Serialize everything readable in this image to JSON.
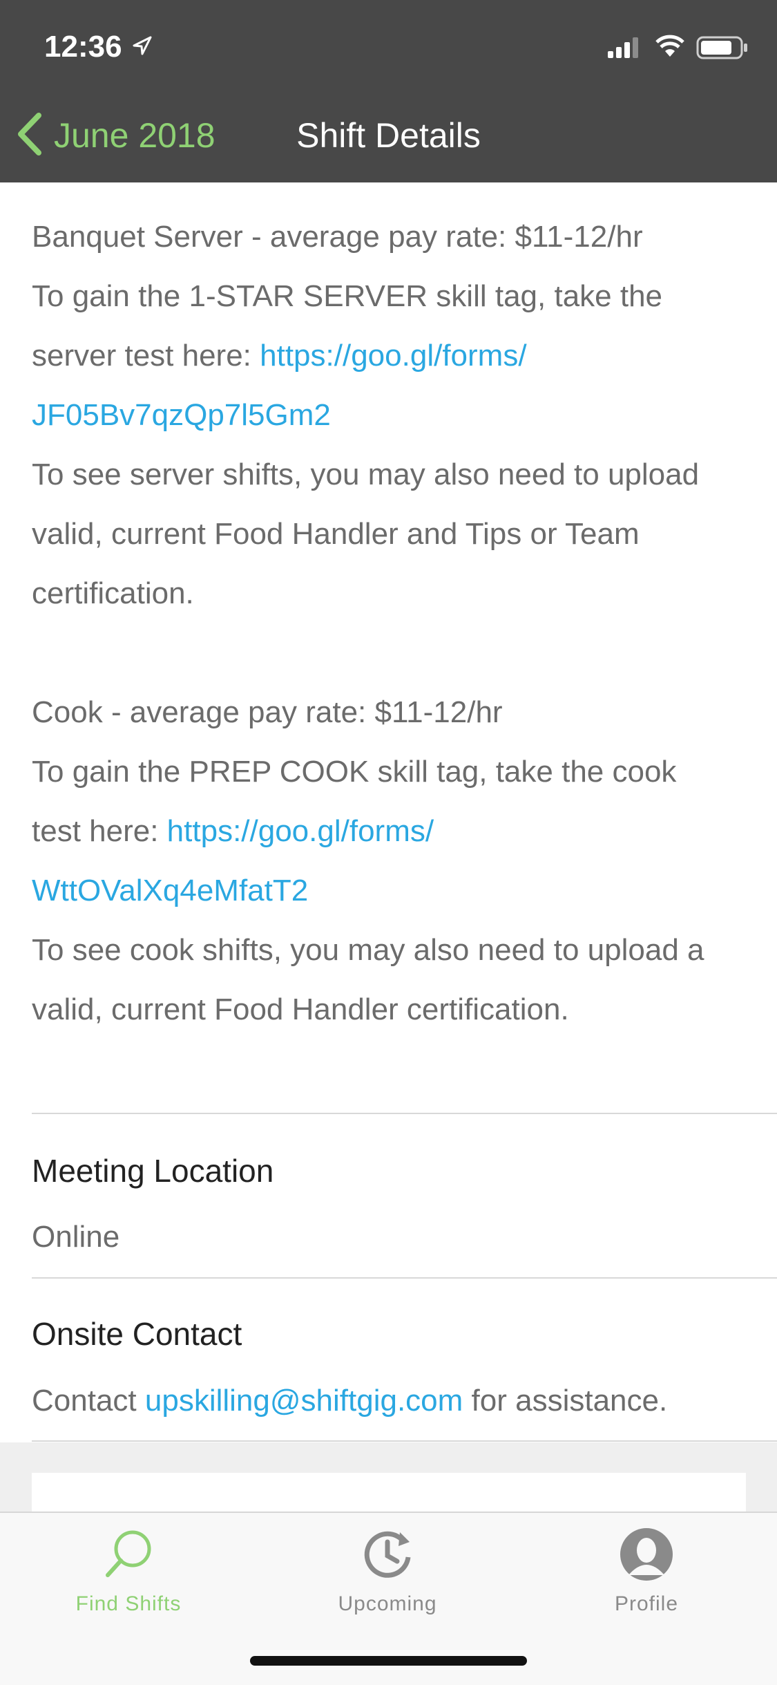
{
  "status_bar": {
    "time": "12:36"
  },
  "nav": {
    "back_label": "June 2018",
    "title": "Shift Details"
  },
  "description": {
    "lines": [
      [
        {
          "text": "Banquet Server - average pay rate: $11-12/hr",
          "link": false
        }
      ],
      [
        {
          "text": "To gain the 1-STAR SERVER skill tag, take the",
          "link": false
        }
      ],
      [
        {
          "text": "server test here: ",
          "link": false
        },
        {
          "text": "https://goo.gl/forms/",
          "link": true
        }
      ],
      [
        {
          "text": "JF05Bv7qzQp7l5Gm2",
          "link": true
        }
      ],
      [
        {
          "text": "To see server shifts, you may also need to upload",
          "link": false
        }
      ],
      [
        {
          "text": "valid, current Food Handler and Tips or Team",
          "link": false
        }
      ],
      [
        {
          "text": "certification.",
          "link": false
        }
      ],
      [],
      [
        {
          "text": "Cook - average pay rate: $11-12/hr",
          "link": false
        }
      ],
      [
        {
          "text": "To gain the PREP COOK skill tag, take the cook",
          "link": false
        }
      ],
      [
        {
          "text": "test here: ",
          "link": false
        },
        {
          "text": "https://goo.gl/forms/",
          "link": true
        }
      ],
      [
        {
          "text": "WttOValXq4eMfatT2",
          "link": true
        }
      ],
      [
        {
          "text": "To see cook shifts, you may also need to upload a",
          "link": false
        }
      ],
      [
        {
          "text": "valid, current Food Handler certification.",
          "link": false
        }
      ]
    ]
  },
  "meeting_location": {
    "title": "Meeting Location",
    "value": "Online"
  },
  "onsite_contact": {
    "title": "Onsite Contact",
    "prefix": "Contact ",
    "email": "upskilling@shiftgig.com",
    "suffix": " for assistance."
  },
  "tabs": [
    {
      "label": "Find Shifts",
      "icon": "search-icon",
      "active": true
    },
    {
      "label": "Upcoming",
      "icon": "clock-history-icon",
      "active": false
    },
    {
      "label": "Profile",
      "icon": "profile-icon",
      "active": false
    }
  ],
  "colors": {
    "header_bg": "#484848",
    "accent_green": "#8fd174",
    "link_blue": "#2aa7e1",
    "inactive_tab": "#8a8a8a"
  }
}
